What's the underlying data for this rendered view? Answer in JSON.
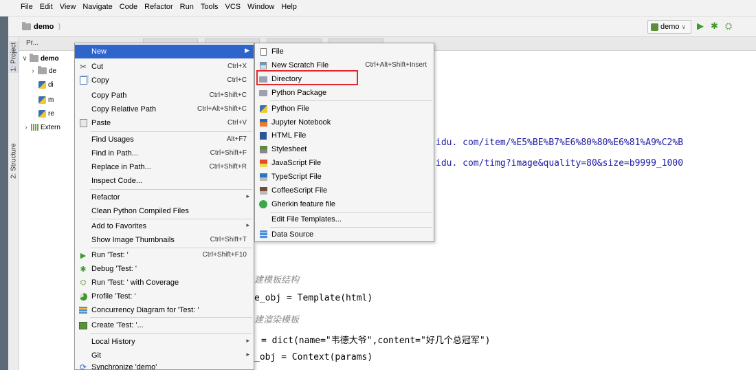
{
  "menubar": {
    "items": [
      "File",
      "Edit",
      "View",
      "Navigate",
      "Code",
      "Refactor",
      "Run",
      "Tools",
      "VCS",
      "Window",
      "Help"
    ]
  },
  "navbar": {
    "project_name": "demo",
    "run_config": "demo"
  },
  "toolwindow": {
    "project_selector": "Pr...",
    "side_tabs": {
      "project": "1: Project",
      "structure": "2: Structure"
    }
  },
  "tree": {
    "root": "demo",
    "items": [
      {
        "name": "de",
        "icon": "folder"
      },
      {
        "name": "di",
        "icon": "python-file"
      },
      {
        "name": "m",
        "icon": "python-file"
      },
      {
        "name": "re",
        "icon": "python-file"
      },
      {
        "name": "Extern",
        "icon": "library"
      }
    ]
  },
  "editor": {
    "lines": [
      {
        "text": "idu. com/item/%E5%BE%B7%E6%80%80%E6%81%A9%C2%B",
        "kind": "url"
      },
      {
        "text": "idu. com/timg?image&quality=80&size=b9999_1000",
        "kind": "url"
      },
      {
        "text": "建模板结构",
        "kind": "comment"
      },
      {
        "text": "e_obj = Template(html)",
        "kind": "code"
      },
      {
        "text": "建渲染模板",
        "kind": "comment"
      },
      {
        "text": "= dict(name=\"韦德大爷\",content=\"好几个总冠军\")",
        "kind": "code-dict"
      },
      {
        "text": "_obj = Context(params)",
        "kind": "code"
      }
    ]
  },
  "context_menu": {
    "items": [
      {
        "label": "New",
        "shortcut": "",
        "submenu": true,
        "icon": "",
        "selected": true
      },
      {
        "label": "Cut",
        "shortcut": "Ctrl+X",
        "icon": "cut-icon"
      },
      {
        "label": "Copy",
        "shortcut": "Ctrl+C",
        "icon": "copy-icon"
      },
      {
        "label": "Copy Path",
        "shortcut": "Ctrl+Shift+C",
        "icon": ""
      },
      {
        "label": "Copy Relative Path",
        "shortcut": "Ctrl+Alt+Shift+C",
        "icon": ""
      },
      {
        "label": "Paste",
        "shortcut": "Ctrl+V",
        "icon": "paste-icon"
      },
      {
        "label": "Find Usages",
        "shortcut": "Alt+F7",
        "icon": ""
      },
      {
        "label": "Find in Path...",
        "shortcut": "Ctrl+Shift+F",
        "icon": ""
      },
      {
        "label": "Replace in Path...",
        "shortcut": "Ctrl+Shift+R",
        "icon": ""
      },
      {
        "label": "Inspect Code...",
        "shortcut": "",
        "icon": ""
      },
      {
        "label": "Refactor",
        "shortcut": "",
        "submenu": true,
        "icon": ""
      },
      {
        "label": "Clean Python Compiled Files",
        "shortcut": "",
        "icon": ""
      },
      {
        "label": "Add to Favorites",
        "shortcut": "",
        "submenu": true,
        "icon": ""
      },
      {
        "label": "Show Image Thumbnails",
        "shortcut": "Ctrl+Shift+T",
        "icon": ""
      },
      {
        "label": "Run 'Test: '",
        "shortcut": "Ctrl+Shift+F10",
        "icon": "run-icon"
      },
      {
        "label": "Debug 'Test: '",
        "shortcut": "",
        "icon": "debug-icon"
      },
      {
        "label": "Run 'Test: ' with Coverage",
        "shortcut": "",
        "icon": "coverage-icon"
      },
      {
        "label": "Profile 'Test: '",
        "shortcut": "",
        "icon": "profile-icon"
      },
      {
        "label": "Concurrency Diagram for  'Test: '",
        "shortcut": "",
        "icon": "concurrency-icon"
      },
      {
        "label": "Create 'Test: '...",
        "shortcut": "",
        "icon": "create-icon"
      },
      {
        "label": "Local History",
        "shortcut": "",
        "submenu": true,
        "icon": ""
      },
      {
        "label": "Git",
        "shortcut": "",
        "submenu": true,
        "icon": ""
      },
      {
        "label": "Synchronize 'demo'",
        "shortcut": "",
        "icon": "sync-icon"
      }
    ]
  },
  "submenu": {
    "items": [
      {
        "label": "File",
        "shortcut": "",
        "icon": "file-icon"
      },
      {
        "label": "New Scratch File",
        "shortcut": "Ctrl+Alt+Shift+Insert",
        "icon": "scratch-icon"
      },
      {
        "label": "Directory",
        "shortcut": "",
        "icon": "directory-icon"
      },
      {
        "label": "Python Package",
        "shortcut": "",
        "icon": "python-package-icon"
      },
      {
        "label": "Python File",
        "shortcut": "",
        "icon": "python-file-icon"
      },
      {
        "label": "Jupyter Notebook",
        "shortcut": "",
        "icon": "jupyter-icon"
      },
      {
        "label": "HTML File",
        "shortcut": "",
        "icon": "html-icon"
      },
      {
        "label": "Stylesheet",
        "shortcut": "",
        "icon": "css-icon"
      },
      {
        "label": "JavaScript File",
        "shortcut": "",
        "icon": "js-icon"
      },
      {
        "label": "TypeScript File",
        "shortcut": "",
        "icon": "ts-icon"
      },
      {
        "label": "CoffeeScript File",
        "shortcut": "",
        "icon": "coffee-icon"
      },
      {
        "label": "Gherkin feature file",
        "shortcut": "",
        "icon": "gherkin-icon"
      },
      {
        "label": "Edit File Templates...",
        "shortcut": "",
        "icon": ""
      },
      {
        "label": "Data Source",
        "shortcut": "",
        "icon": "data-source-icon"
      }
    ]
  },
  "colors": {
    "selection": "#2f65ca",
    "highlight_box": "#e0282e",
    "menu_bg": "#f5f5f5"
  }
}
